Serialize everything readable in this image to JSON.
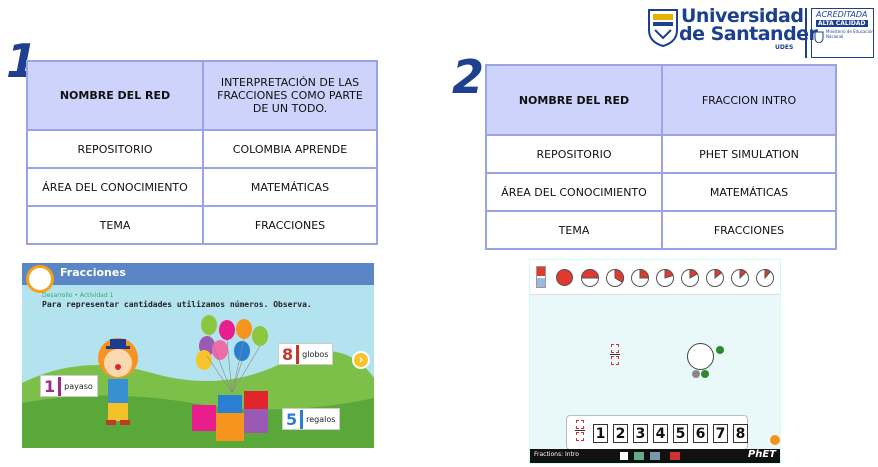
{
  "logo": {
    "name_line1": "Universidad",
    "name_line2": "de Santander",
    "abbrev": "UDES",
    "accreditation_line1": "ACREDITADA",
    "accreditation_line2": "ALTA CALIDAD",
    "accreditation_detail": "Ministerio de Educación Nacional",
    "brand_color": "#1c3f8f"
  },
  "section1": {
    "number": "1",
    "table": [
      {
        "key": "NOMBRE DEL RED",
        "value": "INTERPRETACIÓN DE LAS FRACCIONES COMO PARTE DE UN TODO."
      },
      {
        "key": "REPOSITORIO",
        "value": "COLOMBIA APRENDE"
      },
      {
        "key": "ÁREA DEL CONOCIMIENTO",
        "value": "MATEMÁTICAS"
      },
      {
        "key": "TEMA",
        "value": "FRACCIONES"
      }
    ],
    "image": {
      "title": "Fracciones",
      "breadcrumb": "Desarrollo  •  Actividad 1",
      "instruction": "Para representar cantidades utilizamos números. Observa.",
      "labels": [
        {
          "num": "1",
          "text": "payaso"
        },
        {
          "num": "8",
          "text": "globos"
        },
        {
          "num": "5",
          "text": "regalos"
        }
      ]
    }
  },
  "section2": {
    "number": "2",
    "table": [
      {
        "key": "NOMBRE DEL RED",
        "value": "FRACCION INTRO"
      },
      {
        "key": "REPOSITORIO",
        "value": "PHET SIMULATION"
      },
      {
        "key": "ÁREA DEL CONOCIMIENTO",
        "value": "MATEMÁTICAS"
      },
      {
        "key": "TEMA",
        "value": "FRACCIONES"
      }
    ],
    "image": {
      "digits": [
        "1",
        "2",
        "3",
        "4",
        "5",
        "6",
        "7",
        "8"
      ],
      "footer_title": "Fractions: Intro",
      "footer_brand": "PhET"
    }
  }
}
